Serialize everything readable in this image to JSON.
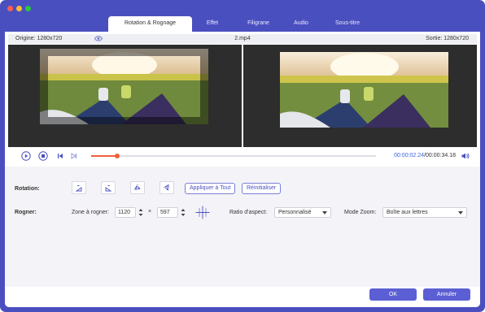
{
  "window": {
    "tabs": [
      {
        "label": "Rotation & Rognage",
        "active": true
      },
      {
        "label": "Effet",
        "active": false
      },
      {
        "label": "Filigrane",
        "active": false
      },
      {
        "label": "Audio",
        "active": false
      },
      {
        "label": "Sous-titre",
        "active": false
      }
    ]
  },
  "preview": {
    "origin_label": "Origine: 1280x720",
    "filename": "2.mp4",
    "output_label": "Sortie: 1280x720"
  },
  "playback": {
    "current_time": "00:00:02.24",
    "separator": "/",
    "total_time": "00:00:34.18",
    "progress_fraction": 0.09
  },
  "rotation": {
    "label": "Rotation:",
    "apply_all_label": "Appliquer à Tout",
    "reset_label": "Réinitialiser",
    "buttons": [
      "rotate-left",
      "rotate-right",
      "flip-horizontal",
      "flip-vertical"
    ]
  },
  "crop": {
    "label": "Rogner:",
    "zone_label": "Zone à rogner:",
    "width_value": "1120",
    "times": "×",
    "height_value": "597",
    "aspect_label": "Ratio d'aspect:",
    "aspect_value": "Personnalisé",
    "zoom_label": "Mode Zoom:",
    "zoom_value": "Boîte aux lettres"
  },
  "footer": {
    "ok_label": "OK",
    "cancel_label": "Annuler"
  },
  "colors": {
    "frame": "#4a4fbf",
    "accent": "#5b5fd3",
    "timecode": "#3d5fe0",
    "scrubber": "#f0603c"
  }
}
